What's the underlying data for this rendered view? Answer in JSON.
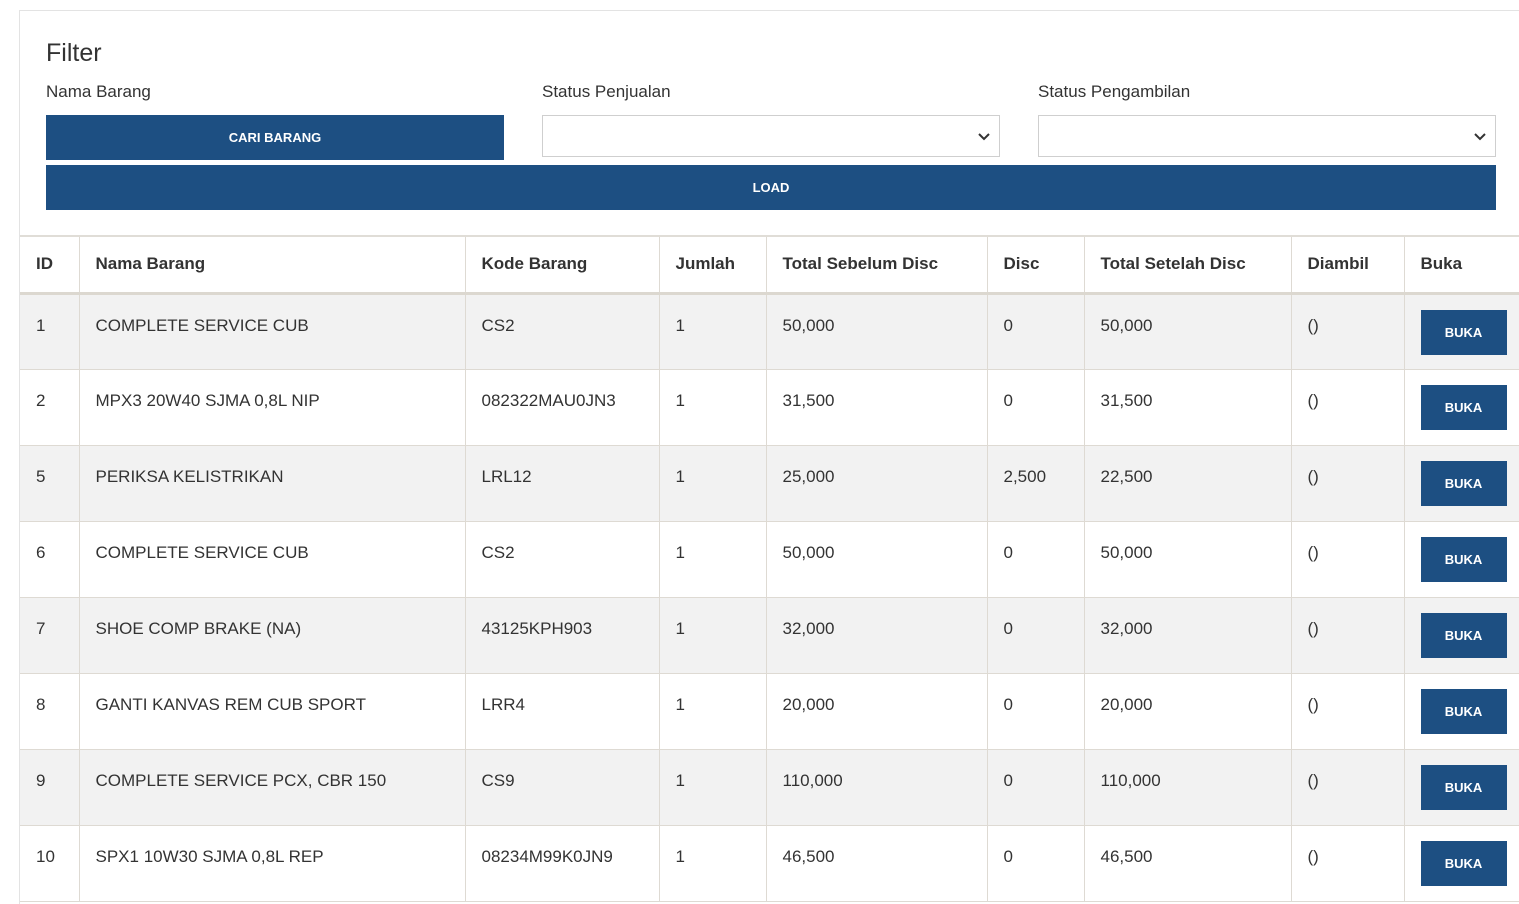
{
  "filter": {
    "title": "Filter",
    "nama_barang_label": "Nama Barang",
    "cari_barang_label": "CARI BARANG",
    "status_penjualan_label": "Status Penjualan",
    "status_penjualan_value": "",
    "status_pengambilan_label": "Status Pengambilan",
    "status_pengambilan_value": "",
    "load_label": "LOAD"
  },
  "table": {
    "headers": [
      "ID",
      "Nama Barang",
      "Kode Barang",
      "Jumlah",
      "Total Sebelum Disc",
      "Disc",
      "Total Setelah Disc",
      "Diambil",
      "Buka"
    ],
    "button_label": "BUKA",
    "rows": [
      {
        "id": "1",
        "nama": "COMPLETE SERVICE CUB",
        "kode": "CS2",
        "jumlah": "1",
        "total_sebelum": "50,000",
        "disc": "0",
        "total_setelah": "50,000",
        "diambil": "()"
      },
      {
        "id": "2",
        "nama": "MPX3 20W40 SJMA 0,8L NIP",
        "kode": "082322MAU0JN3",
        "jumlah": "1",
        "total_sebelum": "31,500",
        "disc": "0",
        "total_setelah": "31,500",
        "diambil": "()"
      },
      {
        "id": "5",
        "nama": "PERIKSA KELISTRIKAN",
        "kode": "LRL12",
        "jumlah": "1",
        "total_sebelum": "25,000",
        "disc": "2,500",
        "total_setelah": "22,500",
        "diambil": "()"
      },
      {
        "id": "6",
        "nama": "COMPLETE SERVICE CUB",
        "kode": "CS2",
        "jumlah": "1",
        "total_sebelum": "50,000",
        "disc": "0",
        "total_setelah": "50,000",
        "diambil": "()"
      },
      {
        "id": "7",
        "nama": "SHOE COMP BRAKE (NA)",
        "kode": "43125KPH903",
        "jumlah": "1",
        "total_sebelum": "32,000",
        "disc": "0",
        "total_setelah": "32,000",
        "diambil": "()"
      },
      {
        "id": "8",
        "nama": "GANTI KANVAS REM CUB SPORT",
        "kode": "LRR4",
        "jumlah": "1",
        "total_sebelum": "20,000",
        "disc": "0",
        "total_setelah": "20,000",
        "diambil": "()"
      },
      {
        "id": "9",
        "nama": "COMPLETE SERVICE PCX, CBR 150",
        "kode": "CS9",
        "jumlah": "1",
        "total_sebelum": "110,000",
        "disc": "0",
        "total_setelah": "110,000",
        "diambil": "()"
      },
      {
        "id": "10",
        "nama": "SPX1 10W30 SJMA 0,8L REP",
        "kode": "08234M99K0JN9",
        "jumlah": "1",
        "total_sebelum": "46,500",
        "disc": "0",
        "total_setelah": "46,500",
        "diambil": "()"
      }
    ]
  },
  "colors": {
    "primary": "#1d4f82",
    "row_alt": "#f2f2f2"
  }
}
